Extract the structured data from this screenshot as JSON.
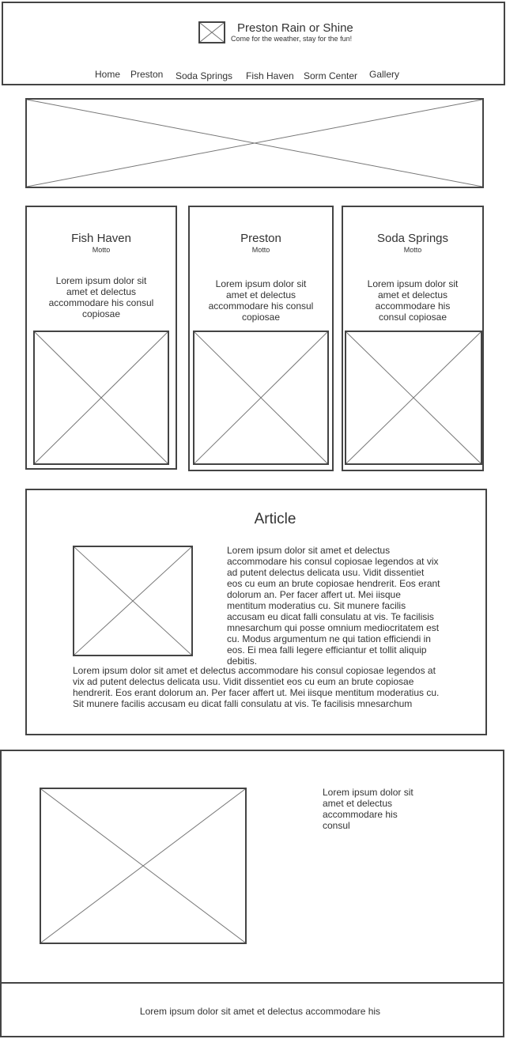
{
  "header": {
    "site_title": "Preston Rain or Shine",
    "tagline": "Come for the weather, stay for the fun!",
    "logo_icon": "image-placeholder-icon"
  },
  "nav": {
    "items": [
      {
        "label": "Home"
      },
      {
        "label": "Preston"
      },
      {
        "label": "Soda Springs"
      },
      {
        "label": "Fish Haven"
      },
      {
        "label": "Sorm Center"
      },
      {
        "label": "Gallery"
      }
    ]
  },
  "cards": [
    {
      "title": "Fish Haven",
      "motto": "Motto",
      "body": "Lorem ipsum dolor sit amet et delectus accommodare his consul copiosae"
    },
    {
      "title": "Preston",
      "motto": "Motto",
      "body": "Lorem ipsum dolor sit amet et delectus accommodare his consul copiosae"
    },
    {
      "title": "Soda Springs",
      "motto": "Motto",
      "body": "Lorem ipsum dolor sit amet et delectus accommodare his consul copiosae"
    }
  ],
  "article": {
    "title": "Article",
    "side_text": "Lorem ipsum dolor sit amet et delectus accommodare his consul copiosae legendos at vix ad putent delectus delicata usu. Vidit dissentiet eos cu eum an brute copiosae hendrerit. Eos erant dolorum an. Per facer affert ut. Mei iisque mentitum moderatius cu. Sit munere facilis accusam eu dicat falli consulatu at vis. Te facilisis mnesarchum qui posse omnium mediocritatem est cu. Modus argumentum ne qui tation efficiendi in eos. Ei mea falli legere efficiantur et tollit aliquip debitis.",
    "bottom_text": "Lorem ipsum dolor sit amet et delectus accommodare his consul copiosae legendos at vix ad putent delectus delicata usu. Vidit dissentiet eos cu eum an brute copiosae hendrerit. Eos erant dolorum an. Per facer affert ut. Mei iisque mentitum moderatius cu. Sit munere facilis accusam eu dicat falli consulatu at vis. Te facilisis mnesarchum"
  },
  "promo": {
    "text": "Lorem ipsum dolor sit amet et delectus accommodare his consul"
  },
  "footer": {
    "text": "Lorem ipsum dolor sit amet et delectus accommodare his"
  }
}
